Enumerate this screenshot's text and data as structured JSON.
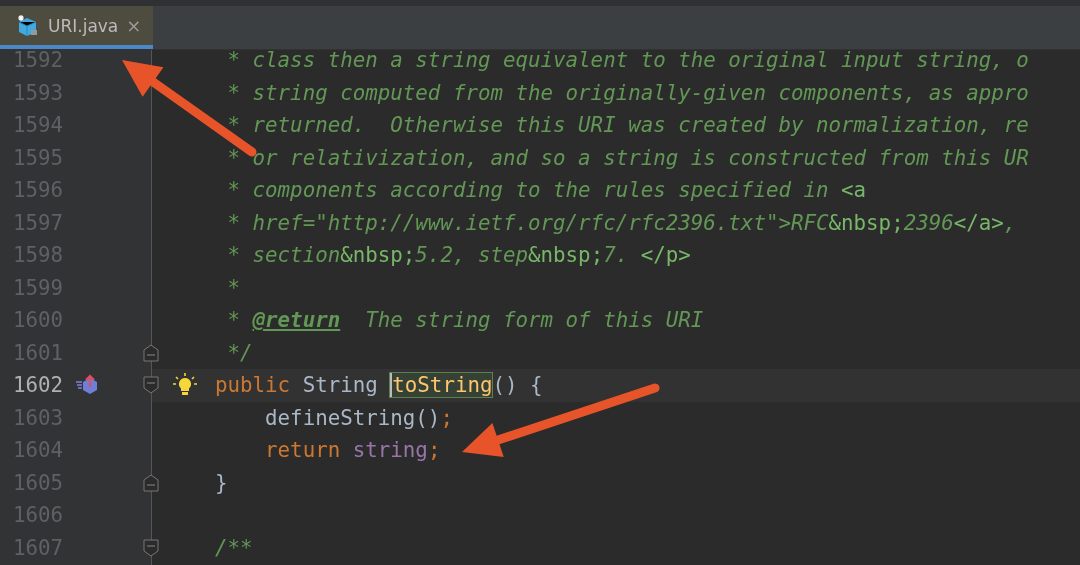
{
  "tabs": [
    {
      "label": "URI.java",
      "selected": true,
      "close_glyph": "×"
    }
  ],
  "lines": [
    {
      "number": "1592",
      "current": false,
      "tokens": [
        {
          "text": " * class then a string equivalent to the original input string, o",
          "kind": "comment"
        }
      ]
    },
    {
      "number": "1593",
      "current": false,
      "tokens": [
        {
          "text": " * string computed from the originally-given components, as appro",
          "kind": "comment"
        }
      ]
    },
    {
      "number": "1594",
      "current": false,
      "tokens": [
        {
          "text": " * returned.  Otherwise this URI was created by normalization, re",
          "kind": "comment"
        }
      ]
    },
    {
      "number": "1595",
      "current": false,
      "tokens": [
        {
          "text": " * or relativization, and so a string is constructed from this UR",
          "kind": "comment"
        }
      ]
    },
    {
      "number": "1596",
      "current": false,
      "tokens": [
        {
          "text": " * components according to the rules specified in ",
          "kind": "comment"
        },
        {
          "text": "<a",
          "kind": "markup"
        }
      ]
    },
    {
      "number": "1597",
      "current": false,
      "tokens": [
        {
          "text": " * href=\"http://www.ietf.org/rfc/rfc2396.txt\">RFC",
          "kind": "comment"
        },
        {
          "text": "&nbsp;",
          "kind": "markup"
        },
        {
          "text": "2396",
          "kind": "comment"
        },
        {
          "text": "</a>",
          "kind": "markup"
        },
        {
          "text": ",",
          "kind": "comment"
        }
      ]
    },
    {
      "number": "1598",
      "current": false,
      "tokens": [
        {
          "text": " * section",
          "kind": "comment"
        },
        {
          "text": "&nbsp;",
          "kind": "markup"
        },
        {
          "text": "5.2, step",
          "kind": "comment"
        },
        {
          "text": "&nbsp;",
          "kind": "markup"
        },
        {
          "text": "7. ",
          "kind": "comment"
        },
        {
          "text": "</p>",
          "kind": "markup"
        }
      ]
    },
    {
      "number": "1599",
      "current": false,
      "tokens": [
        {
          "text": " *",
          "kind": "comment"
        }
      ]
    },
    {
      "number": "1600",
      "current": false,
      "tokens": [
        {
          "text": " * ",
          "kind": "comment"
        },
        {
          "text": "@return",
          "kind": "doctag"
        },
        {
          "text": "  The string form of this URI",
          "kind": "comment"
        }
      ]
    },
    {
      "number": "1601",
      "current": false,
      "fold": {
        "kind": "end"
      },
      "tokens": [
        {
          "text": " */",
          "kind": "comment"
        }
      ]
    },
    {
      "number": "1602",
      "current": true,
      "fold": {
        "kind": "start"
      },
      "gutter_icons": [
        {
          "kind": "override"
        }
      ],
      "intention_bulb": true,
      "tokens": [
        {
          "text": "public",
          "kind": "keyword"
        },
        {
          "text": " String ",
          "kind": "plain"
        },
        {
          "text": "toString",
          "kind": "method-at-caret"
        },
        {
          "text": "() {",
          "kind": "plain"
        }
      ]
    },
    {
      "number": "1603",
      "current": false,
      "tokens": [
        {
          "text": "    defineString()",
          "kind": "plain"
        },
        {
          "text": ";",
          "kind": "keyword"
        }
      ]
    },
    {
      "number": "1604",
      "current": false,
      "tokens": [
        {
          "text": "    return",
          "kind": "keyword"
        },
        {
          "text": " string",
          "kind": "field"
        },
        {
          "text": ";",
          "kind": "keyword"
        }
      ]
    },
    {
      "number": "1605",
      "current": false,
      "fold": {
        "kind": "end"
      },
      "tokens": [
        {
          "text": "}",
          "kind": "plain"
        }
      ]
    },
    {
      "number": "1606",
      "current": false
    },
    {
      "number": "1607",
      "current": false,
      "fold": {
        "kind": "start"
      },
      "tokens": [
        {
          "text": "/**",
          "kind": "comment"
        }
      ]
    }
  ],
  "annotations": [
    {
      "kind": "arrow"
    },
    {
      "kind": "arrow"
    }
  ]
}
